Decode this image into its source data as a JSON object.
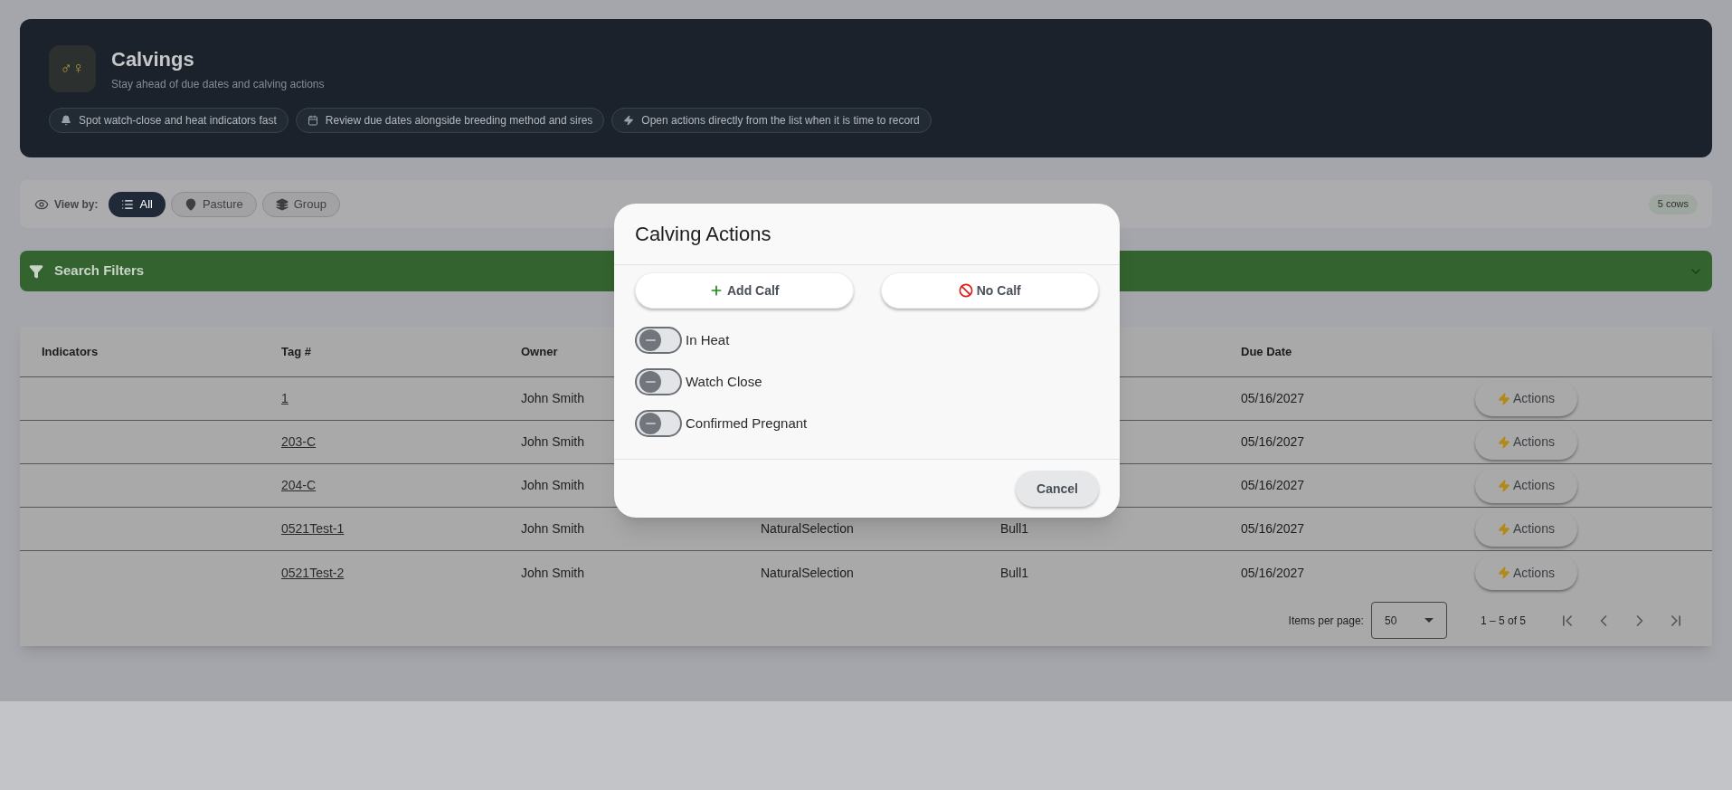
{
  "header": {
    "logo": "♂♀",
    "title": "Calvings",
    "subtitle": "Stay ahead of due dates and calving actions",
    "chips": [
      {
        "kind": "bell",
        "label": "Spot watch-close and heat indicators fast"
      },
      {
        "kind": "calendar",
        "label": "Review due dates alongside breeding method and sires"
      },
      {
        "kind": "bolt",
        "label": "Open actions directly from the list when it is time to record"
      }
    ]
  },
  "view_bar": {
    "label": "View by:",
    "options": [
      {
        "kind": "list",
        "label": "All",
        "selected": true
      },
      {
        "kind": "pin",
        "label": "Pasture",
        "selected": false
      },
      {
        "kind": "layers",
        "label": "Group",
        "selected": false
      }
    ],
    "count": "5 cows"
  },
  "search_filters": {
    "title": "Search Filters"
  },
  "table": {
    "columns": {
      "indicators": "Indicators",
      "tag": "Tag #",
      "owner": "Owner",
      "due_date": "Due Date"
    },
    "rows": [
      {
        "tag": "1",
        "owner": "John Smith",
        "due_date": "05/16/2027",
        "action": "Actions"
      },
      {
        "tag": "203-C",
        "owner": "John Smith",
        "due_date": "05/16/2027",
        "action": "Actions"
      },
      {
        "tag": "204-C",
        "owner": "John Smith",
        "due_date": "05/16/2027",
        "action": "Actions"
      },
      {
        "tag": "0521Test-1",
        "owner": "John Smith",
        "column_4": "NaturalSelection",
        "column_5": "Bull1",
        "due_date": "05/16/2027",
        "action": "Actions"
      },
      {
        "tag": "0521Test-2",
        "owner": "John Smith",
        "column_4": "NaturalSelection",
        "column_5": "Bull1",
        "due_date": "05/16/2027",
        "action": "Actions"
      }
    ]
  },
  "pagination": {
    "items_per_page_label": "Items per page:",
    "page_size": "50",
    "range": "1 – 5 of 5"
  },
  "modal": {
    "title": "Calving Actions",
    "buttons": [
      {
        "kind": "add",
        "label": "Add Calf"
      },
      {
        "kind": "none",
        "label": "No Calf"
      }
    ],
    "toggles": [
      {
        "label": "In Heat",
        "on": false
      },
      {
        "label": "Watch Close",
        "on": false
      },
      {
        "label": "Confirmed Pregnant",
        "on": false
      }
    ],
    "cancel": "Cancel"
  }
}
